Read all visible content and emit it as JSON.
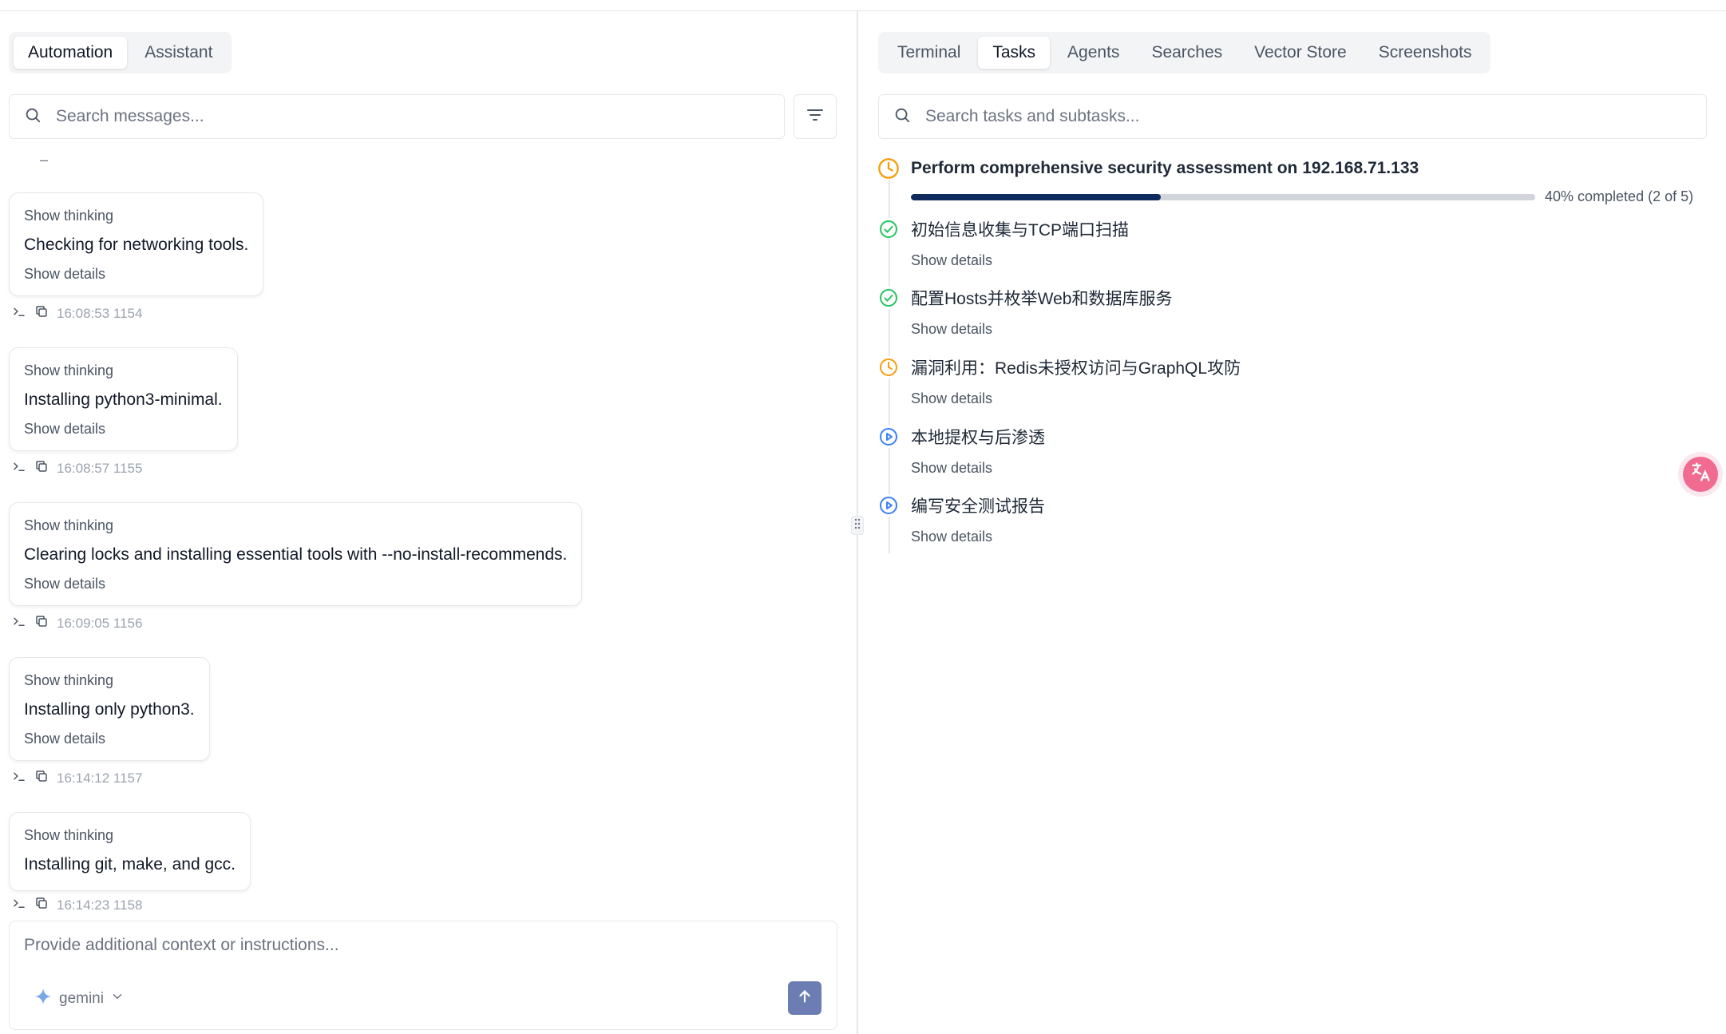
{
  "left": {
    "tabs": [
      {
        "label": "Automation",
        "active": true
      },
      {
        "label": "Assistant",
        "active": false
      }
    ],
    "search": {
      "placeholder": "Search messages..."
    },
    "dash": "–",
    "messages": [
      {
        "thinking": "Show thinking",
        "text": "Checking for networking tools.",
        "details": "Show details",
        "time": "16:08:53 1154"
      },
      {
        "thinking": "Show thinking",
        "text": "Installing python3-minimal.",
        "details": "Show details",
        "time": "16:08:57 1155"
      },
      {
        "thinking": "Show thinking",
        "text": "Clearing locks and installing essential tools with --no-install-recommends.",
        "details": "Show details",
        "time": "16:09:05 1156"
      },
      {
        "thinking": "Show thinking",
        "text": "Installing only python3.",
        "details": "Show details",
        "time": "16:14:12 1157"
      },
      {
        "thinking": "Show thinking",
        "text": "Installing git, make, and gcc.",
        "details": "",
        "time": "16:14:23 1158"
      }
    ],
    "composer": {
      "placeholder": "Provide additional context or instructions...",
      "model": "gemini"
    }
  },
  "right": {
    "tabs": [
      {
        "label": "Terminal",
        "active": false
      },
      {
        "label": "Tasks",
        "active": true
      },
      {
        "label": "Agents",
        "active": false
      },
      {
        "label": "Searches",
        "active": false
      },
      {
        "label": "Vector Store",
        "active": false
      },
      {
        "label": "Screenshots",
        "active": false
      }
    ],
    "search": {
      "placeholder": "Search tasks and subtasks..."
    },
    "task": {
      "title": "Perform comprehensive security assessment on 192.168.71.133",
      "status": "in-progress",
      "progress": 0.4,
      "progress_text": "40% completed (2 of 5)"
    },
    "subtasks": [
      {
        "label": "初始信息收集与TCP端口扫描",
        "status": "done",
        "details": "Show details"
      },
      {
        "label": "配置Hosts并枚举Web和数据库服务",
        "status": "done",
        "details": "Show details"
      },
      {
        "label": "漏洞利用：Redis未授权访问与GraphQL攻防",
        "status": "in-progress",
        "details": "Show details"
      },
      {
        "label": "本地提权与后渗透",
        "status": "pending",
        "details": "Show details"
      },
      {
        "label": "编写安全测试报告",
        "status": "pending",
        "details": "Show details"
      }
    ]
  },
  "colors": {
    "done": "#22c55e",
    "in_progress": "#f59e0b",
    "pending": "#3b82f6",
    "progress_fill": "#0f2a5c",
    "send": "#6b7db3"
  },
  "icons": {
    "search": "search-icon",
    "filter": "filter-icon",
    "terminal": "terminal-icon",
    "copy": "copy-icon",
    "send": "arrow-up-icon",
    "model": "sparkle-icon",
    "translate": "translate-icon"
  }
}
